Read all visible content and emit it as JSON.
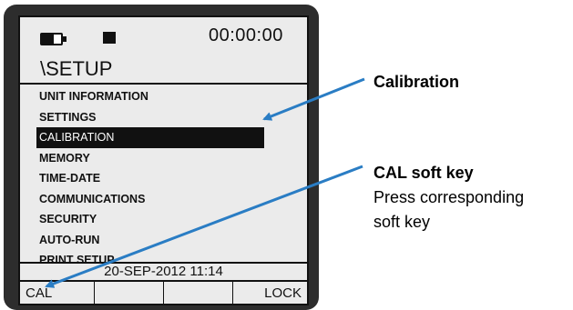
{
  "status": {
    "clock": "00:00:00"
  },
  "menu": {
    "title": "\\SETUP",
    "items": [
      {
        "label": "UNIT INFORMATION",
        "selected": false
      },
      {
        "label": "SETTINGS",
        "selected": false
      },
      {
        "label": "CALIBRATION",
        "selected": true
      },
      {
        "label": "MEMORY",
        "selected": false
      },
      {
        "label": "TIME-DATE",
        "selected": false
      },
      {
        "label": "COMMUNICATIONS",
        "selected": false
      },
      {
        "label": "SECURITY",
        "selected": false
      },
      {
        "label": "AUTO-RUN",
        "selected": false
      },
      {
        "label": "PRINT SETUP",
        "selected": false
      }
    ]
  },
  "datetime": "20-SEP-2012   11:14",
  "softkeys": [
    "CAL",
    "",
    "",
    "LOCK"
  ],
  "annotations": {
    "calibration": "Calibration",
    "cal_key_title": "CAL soft key",
    "cal_key_desc_1": "Press corresponding",
    "cal_key_desc_2": "soft key"
  },
  "colors": {
    "arrow": "#2a7dc4",
    "screen": "#ebebeb",
    "bezel": "#2d2d2d"
  }
}
